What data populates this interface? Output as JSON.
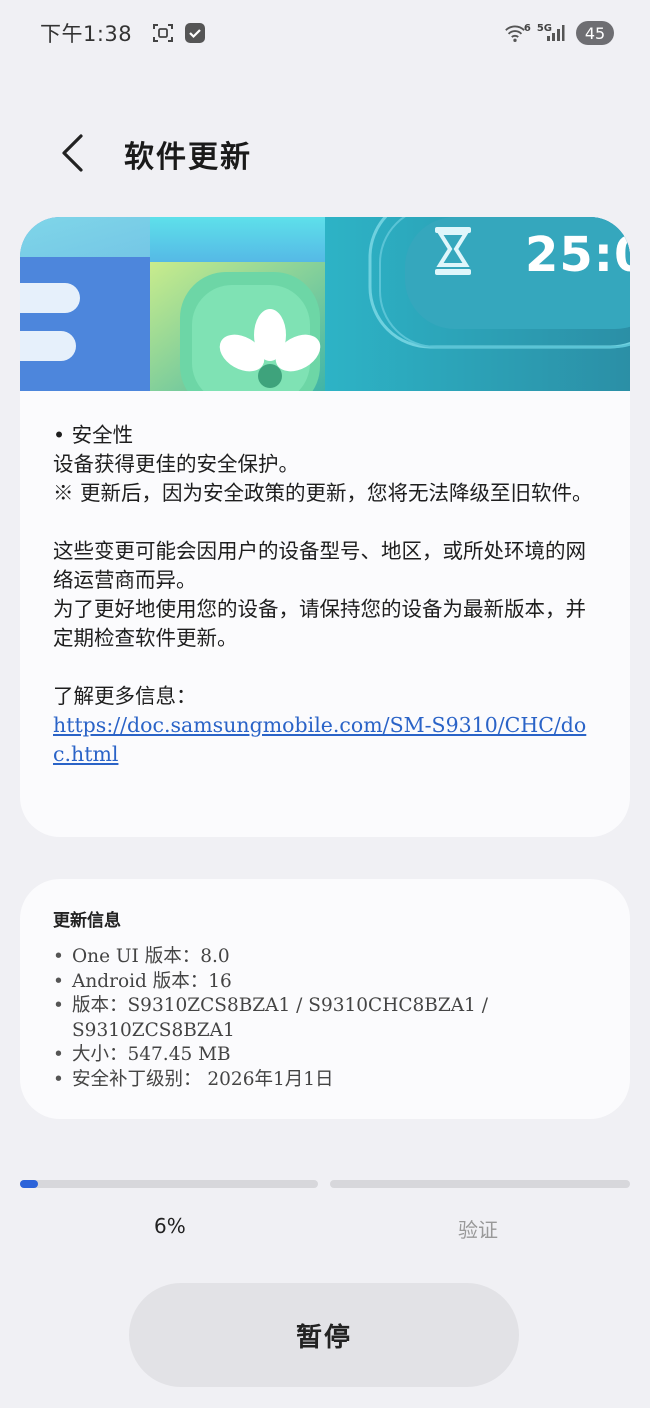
{
  "status_bar": {
    "time": "下午1:38",
    "network_small": "6",
    "network_type": "5G",
    "battery": "45"
  },
  "header": {
    "title": "软件更新"
  },
  "banner": {
    "clock_text": "25:0"
  },
  "release_notes": {
    "lines_block_1": [
      "• 安全性",
      "设备获得更佳的安全保护。",
      "※ 更新后，因为安全政策的更新，您将无法降级至旧软件。"
    ],
    "lines_block_2": [
      "这些变更可能会因用户的设备型号、地区，或所处环境的网络运营商而异。",
      "为了更好地使用您的设备，请保持您的设备为最新版本，并定期检查软件更新。"
    ],
    "more_info_label": "了解更多信息：",
    "more_info_link": "https://doc.samsungmobile.com/SM-S9310/CHC/doc.html"
  },
  "update_info": {
    "title": "更新信息",
    "items": [
      "One UI 版本：8.0",
      "Android 版本：16",
      "版本：S9310ZCS8BZA1 / S9310CHC8BZA1 / S9310ZCS8BZA1",
      "大小：547.45 MB",
      "安全补丁级别： 2026年1月1日"
    ]
  },
  "progress": {
    "percent_label": "6%",
    "fraction": 0.06,
    "verify_label": "验证"
  },
  "actions": {
    "pause_label": "暂停"
  },
  "colors": {
    "accent": "#2c63d9",
    "link": "#2a63c7",
    "background": "#f0f0f4",
    "card": "#fbfbfd"
  }
}
